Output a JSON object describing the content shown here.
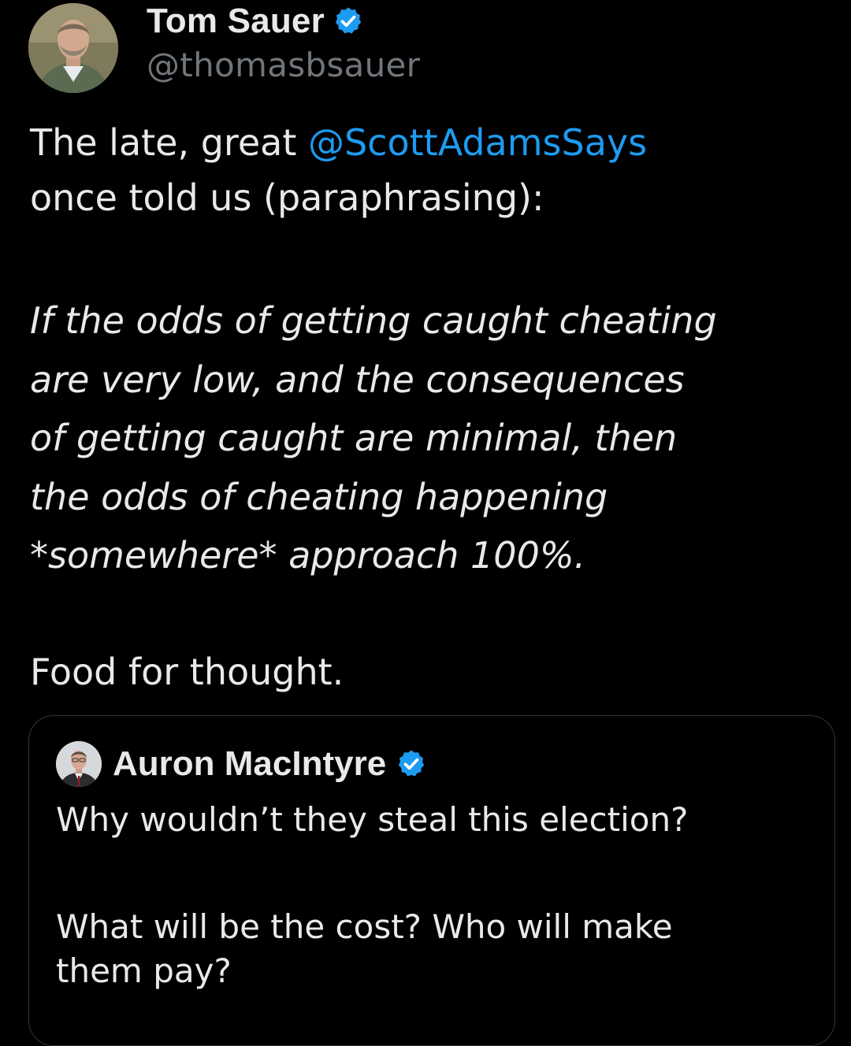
{
  "author": {
    "name": "Tom Sauer",
    "handle": "@thomasbsauer",
    "verified_icon": "verified-badge-icon"
  },
  "tweet": {
    "intro_prefix": "The late, great ",
    "mention": "@ScottAdamsSays",
    "intro_suffix": "once told us (paraphrasing):",
    "quote_lines": [
      "If the odds of getting caught cheating",
      "are very low, and the consequences",
      "of getting caught are minimal, then",
      "the odds of cheating happening",
      "*somewhere* approach 100%."
    ],
    "closing": "Food for thought."
  },
  "quoted_tweet": {
    "author_name": "Auron MacIntyre",
    "verified_icon": "verified-badge-icon",
    "text_line1": "Why wouldn’t they steal this election?",
    "text_line2": "What will be the cost? Who will make",
    "text_line3": "them pay?"
  },
  "colors": {
    "background": "#000000",
    "text_primary": "#e7e9ea",
    "text_secondary": "#71767b",
    "accent": "#1d9bf0",
    "border": "#2f3336"
  }
}
